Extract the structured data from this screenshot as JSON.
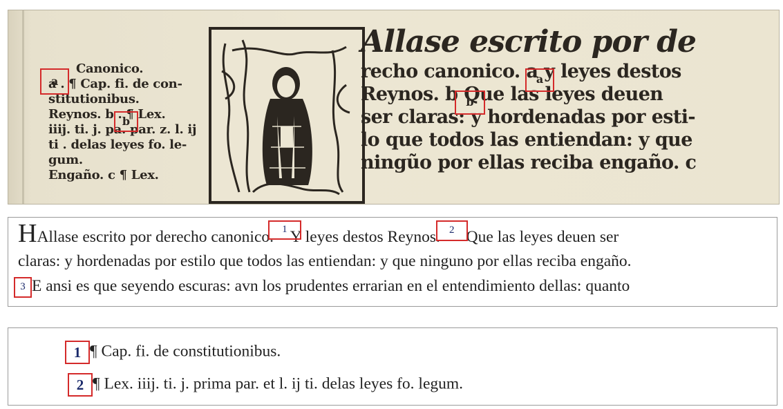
{
  "facsimile": {
    "margin_note_lines": [
      "Canonico.",
      "a . ¶ Cap. fi. de con-",
      "stitutionibus.",
      "Reynos. b . ¶ Lex.",
      "iiij. ti. j. pa. par. z. l. ij",
      "ti . delas leyes fo. le-",
      "gum.",
      "Engaño. c ¶ Lex."
    ],
    "main_text_lines": [
      "Allase escrito por de",
      "recho canonico. a y leyes destos",
      "Reynos. b Que las leyes deuen",
      "ser claras: y hordenadas por esti-",
      "lo que todos las entiendan: y que",
      "ningũo por ellas reciba engaño. c"
    ],
    "boxed_markers": [
      "a",
      "b",
      "a"
    ]
  },
  "transcription": {
    "initial": "H",
    "line1_a": "Allase escrito por derecho canonico.",
    "marker1": "1",
    "line1_b": "Y leyes destos Reynos.",
    "marker2": "2",
    "line1_c": "Que las leyes deuen ser",
    "line2": "claras: y hordenadas por estilo que todos las entiendan: y que ninguno por ellas reciba engaño.",
    "marker3": "3",
    "line3": "E ansi es que seyendo escuras: avn los prudentes errarian en el entendimiento dellas: quanto"
  },
  "notes": [
    {
      "num": "1",
      "text": "¶ Cap. fi. de constitutionibus."
    },
    {
      "num": "2",
      "text": "¶ Lex. iiij. ti. j. prima par. et l. ij ti. delas leyes fo. legum."
    }
  ],
  "colors": {
    "highlight": "#d42a2a",
    "marker_text": "#1b2a6b",
    "paper": "#ece6d3",
    "ink": "#2b2620"
  }
}
